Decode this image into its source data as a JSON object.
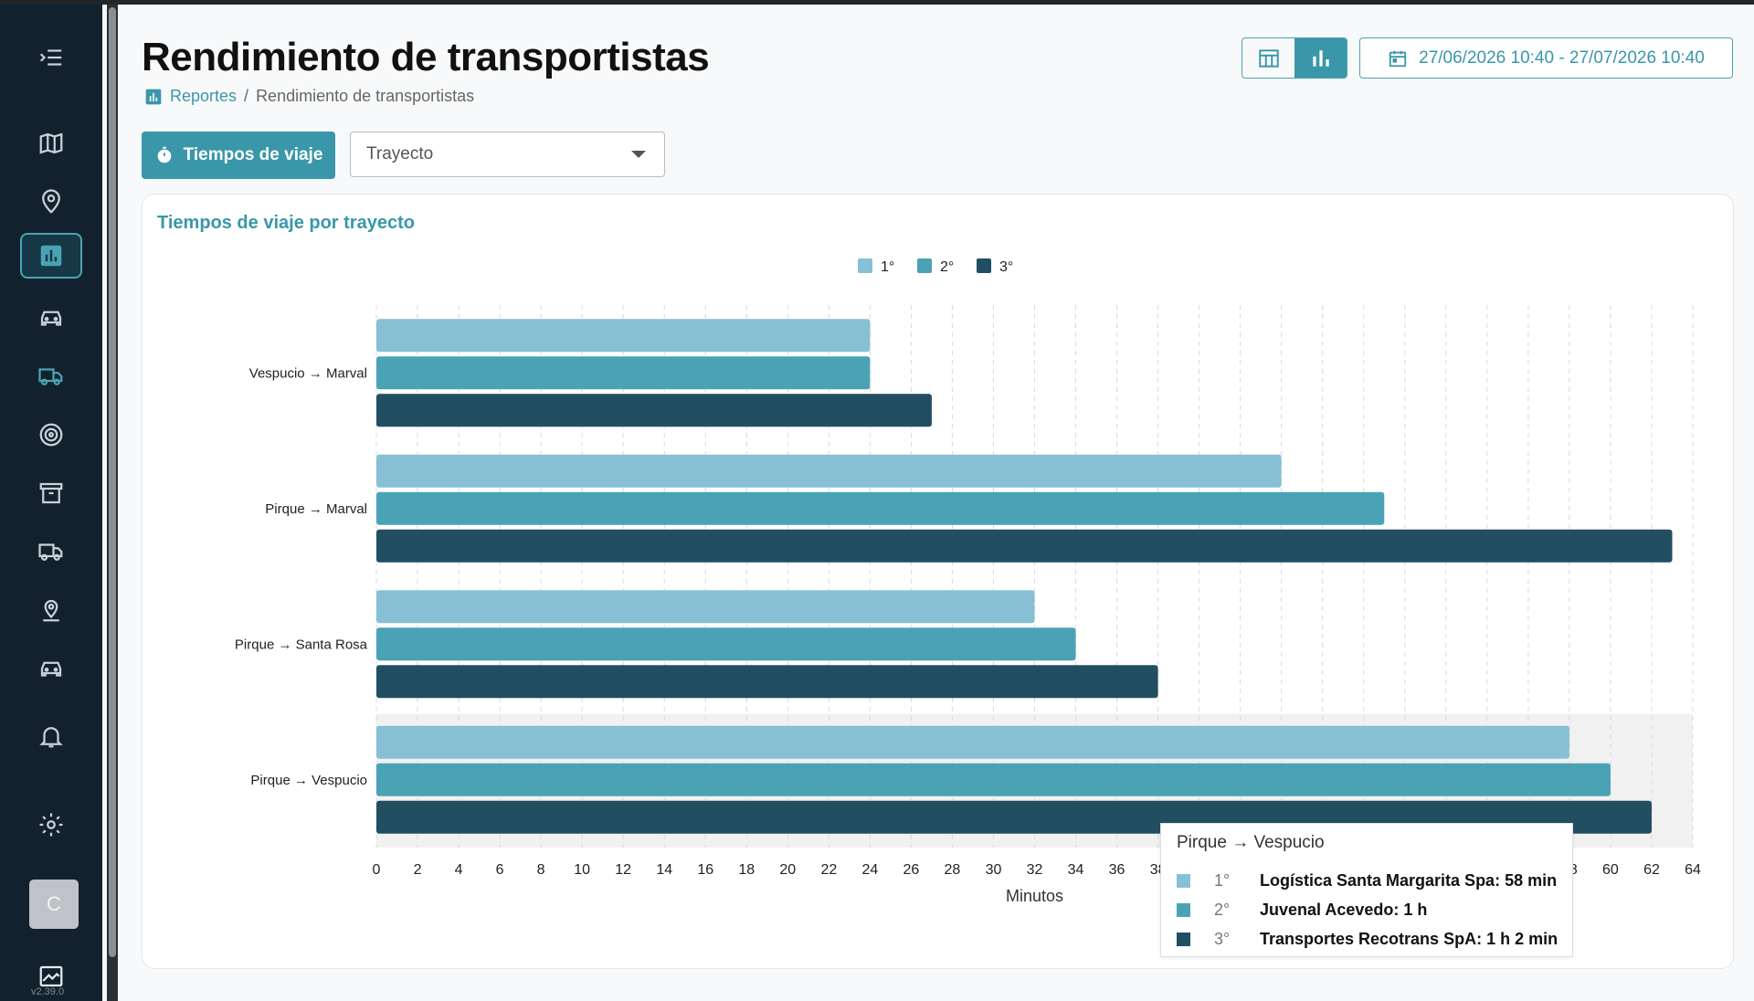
{
  "page": {
    "title": "Rendimiento de transportistas",
    "breadcrumb": {
      "link": "Reportes",
      "sep": "/",
      "current": "Rendimiento de transportistas"
    },
    "date_range": "27/06/2026 10:40 - 27/07/2026 10:40"
  },
  "sidebar": {
    "icons": [
      "menu-collapse-icon",
      "map-icon",
      "location-pin-icon",
      "bar-chart-icon",
      "car-icon",
      "truck-icon",
      "target-icon",
      "archive-icon",
      "delivery-truck-icon",
      "map-pin-icon",
      "car-icon",
      "bell-icon",
      "gear-icon"
    ],
    "active_index": 3,
    "avatar_letter": "C",
    "version": "v2.39.0"
  },
  "toolbar": {
    "travel_time_button": "Tiempos de viaje",
    "select_value": "Trayecto"
  },
  "colors": {
    "accent": "#3a97a9",
    "rank1": "#87c0d5",
    "rank2": "#4aa3b4",
    "rank3": "#224e62"
  },
  "chart_data": {
    "type": "bar",
    "orientation": "horizontal",
    "title": "Tiempos de viaje por trayecto",
    "xlabel": "Minutos",
    "categories": [
      "Vespucio → Marval",
      "Pirque → Marval",
      "Pirque → Santa Rosa",
      "Pirque → Vespucio"
    ],
    "series": [
      {
        "name": "1°",
        "color": "#87c0d5",
        "values": [
          24,
          44,
          32,
          58
        ]
      },
      {
        "name": "2°",
        "color": "#4aa3b4",
        "values": [
          24,
          49,
          34,
          60
        ]
      },
      {
        "name": "3°",
        "color": "#224e62",
        "values": [
          27,
          63,
          38,
          62
        ]
      }
    ],
    "xlim": [
      0,
      64
    ],
    "xticks": [
      0,
      2,
      4,
      6,
      8,
      10,
      12,
      14,
      16,
      18,
      20,
      22,
      24,
      26,
      28,
      30,
      32,
      34,
      36,
      38,
      40,
      42,
      44,
      46,
      48,
      50,
      52,
      54,
      56,
      58,
      60,
      62,
      64
    ],
    "grid": "vertical dashed",
    "legend": "top-center",
    "highlighted_category": "Pirque → Vespucio"
  },
  "tooltip": {
    "title": "Pirque → Vespucio",
    "rows": [
      {
        "rank": "1°",
        "text": "Logística Santa Margarita Spa: 58 min"
      },
      {
        "rank": "2°",
        "text": "Juvenal Acevedo: 1 h"
      },
      {
        "rank": "3°",
        "text": "Transportes Recotrans SpA: 1 h 2 min"
      }
    ]
  }
}
